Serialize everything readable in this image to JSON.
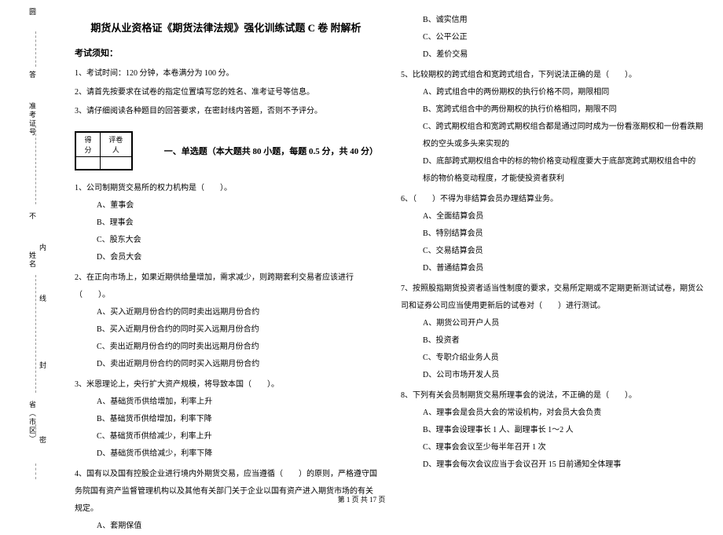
{
  "margin": {
    "label1": "圆",
    "label2": "答",
    "label3": "准考证号",
    "label4": "不",
    "label5": "姓名",
    "label6": "省（市区）",
    "vt1": "不",
    "vt2": "内",
    "vt3": "线",
    "vt4": "封",
    "vt5": "密"
  },
  "header": {
    "title": "期货从业资格证《期货法律法规》强化训练试题 C 卷  附解析",
    "notice_header": "考试须知：",
    "notice1": "1、考试时间：120 分钟，本卷满分为 100 分。",
    "notice2": "2、请首先按要求在试卷的指定位置填写您的姓名、准考证号等信息。",
    "notice3": "3、请仔细阅读各种题目的回答要求，在密封线内答题，否则不予评分。"
  },
  "scorebox": {
    "h1": "得分",
    "h2": "评卷人"
  },
  "section1": {
    "title": "一、单选题（本大题共 80 小题，每题 0.5 分，共 40 分）"
  },
  "q1": {
    "stem": "1、公司制期货交易所的权力机构是（　　）。",
    "a": "A、董事会",
    "b": "B、理事会",
    "c": "C、股东大会",
    "d": "D、会员大会"
  },
  "q2": {
    "stem": "2、在正向市场上，如果近期供给量增加，需求减少，则跨期套利交易者应该进行（　　）。",
    "a": "A、买入近期月份合约的同时卖出远期月份合约",
    "b": "B、买入近期月份合约的同时买入远期月份合约",
    "c": "C、卖出近期月份合约的同时卖出远期月份合约",
    "d": "D、卖出近期月份合约的同时买入远期月份合约"
  },
  "q3": {
    "stem": "3、米恩理论上，央行扩大资产规模，将导致本国（　　）。",
    "a": "A、基础货币供给增加，利率上升",
    "b": "B、基础货币供给增加，利率下降",
    "c": "C、基础货币供给减少，利率上升",
    "d": "D、基础货币供给减少，利率下降"
  },
  "q4": {
    "stem": "4、国有以及国有控股企业进行境内外期货交易，应当遵循（　　）的原则，严格遵守国务院国有资产监督管理机构以及其他有关部门关于企业以国有资产进入期货市场的有关规定。",
    "a": "A、套期保值"
  },
  "q4r": {
    "b": "B、诚实信用",
    "c": "C、公平公正",
    "d": "D、差价交易"
  },
  "q5": {
    "stem": "5、比较期权的跨式组合和宽跨式组合，下列说法正确的是（　　）。",
    "a": "A、跨式组合中的两份期权的执行价格不同，期限相同",
    "b": "B、宽跨式组合中的两份期权的执行价格相同，期限不同",
    "c": "C、跨式期权组合和宽跨式期权组合都是通过同时成为一份看涨期权和一份看跌期权的空头或多头来实现的",
    "d": "D、底部跨式期权组合中的标的物价格变动程度要大于底部宽跨式期权组合中的标的物价格变动程度，才能使投资者获利"
  },
  "q6": {
    "stem": "6、（　　）不得为非结算会员办理结算业务。",
    "a": "A、全面结算会员",
    "b": "B、特别结算会员",
    "c": "C、交易结算会员",
    "d": "D、普通结算会员"
  },
  "q7": {
    "stem": "7、按照股指期货投资者适当性制度的要求，交易所定期或不定期更新测试试卷，期货公司和证券公司应当使用更新后的试卷对（　　）进行测试。",
    "a": "A、期货公司开户人员",
    "b": "B、投资者",
    "c": "C、专职介绍业务人员",
    "d": "D、公司市场开发人员"
  },
  "q8": {
    "stem": "8、下列有关会员制期货交易所理事会的说法，不正确的是（　　）。",
    "a": "A、理事会是会员大会的常设机构，对会员大会负责",
    "b": "B、理事会设理事长 1 人、副理事长 1～2 人",
    "c": "C、理事会会议至少每半年召开 1 次",
    "d": "D、理事会每次会议应当于会议召开 15 日前通知全体理事"
  },
  "footer": {
    "text": "第 1 页 共 17 页"
  }
}
